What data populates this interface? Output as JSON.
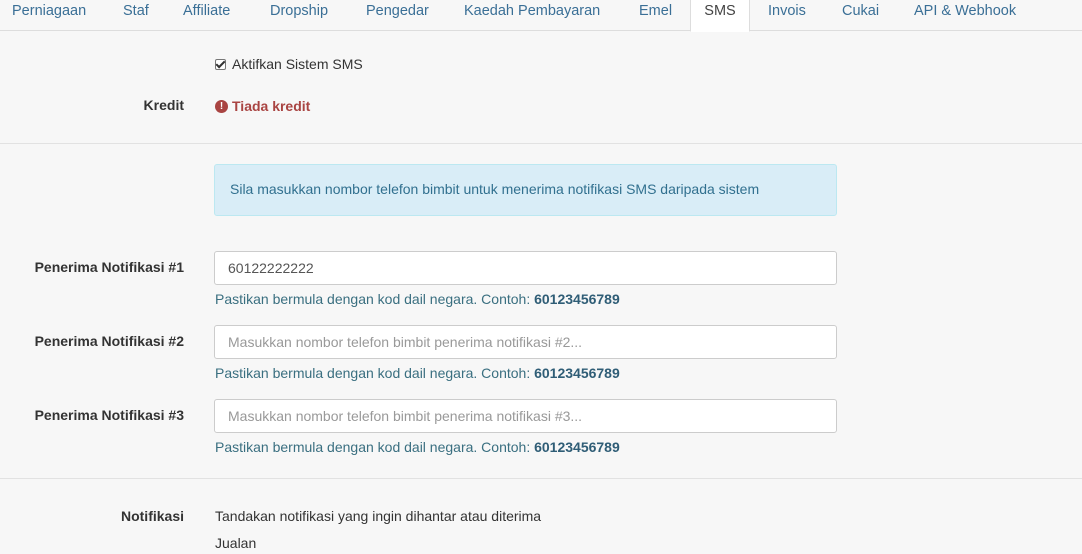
{
  "tabs": [
    {
      "label": "Perniagaan",
      "active": false
    },
    {
      "label": "Staf",
      "active": false
    },
    {
      "label": "Affiliate",
      "active": false
    },
    {
      "label": "Dropship",
      "active": false
    },
    {
      "label": "Pengedar",
      "active": false
    },
    {
      "label": "Kaedah Pembayaran",
      "active": false
    },
    {
      "label": "Emel",
      "active": false
    },
    {
      "label": "SMS",
      "active": true
    },
    {
      "label": "Invois",
      "active": false
    },
    {
      "label": "Cukai",
      "active": false
    },
    {
      "label": "API & Webhook",
      "active": false
    }
  ],
  "sms_toggle": {
    "label": "Aktifkan Sistem SMS",
    "checked": true
  },
  "kredit": {
    "label": "Kredit",
    "status": "Tiada kredit",
    "icon": "exclamation-circle-icon"
  },
  "info_alert": "Sila masukkan nombor telefon bimbit untuk menerima notifikasi SMS daripada sistem",
  "recipients": [
    {
      "label": "Penerima Notifikasi #1",
      "value": "60122222222",
      "placeholder": "",
      "help_text": "Pastikan bermula dengan kod dail negara. Contoh: ",
      "help_example": "60123456789"
    },
    {
      "label": "Penerima Notifikasi #2",
      "value": "",
      "placeholder": "Masukkan nombor telefon bimbit penerima notifikasi #2...",
      "help_text": "Pastikan bermula dengan kod dail negara. Contoh: ",
      "help_example": "60123456789"
    },
    {
      "label": "Penerima Notifikasi #3",
      "value": "",
      "placeholder": "Masukkan nombor telefon bimbit penerima notifikasi #3...",
      "help_text": "Pastikan bermula dengan kod dail negara. Contoh: ",
      "help_example": "60123456789"
    }
  ],
  "notifikasi": {
    "label": "Notifikasi",
    "description": "Tandakan notifikasi yang ingin dihantar atau diterima",
    "group_label": "Jualan"
  },
  "colors": {
    "link": "#3a6f96",
    "danger": "#a94442",
    "info_bg": "#d9edf7",
    "info_text": "#31708f"
  }
}
